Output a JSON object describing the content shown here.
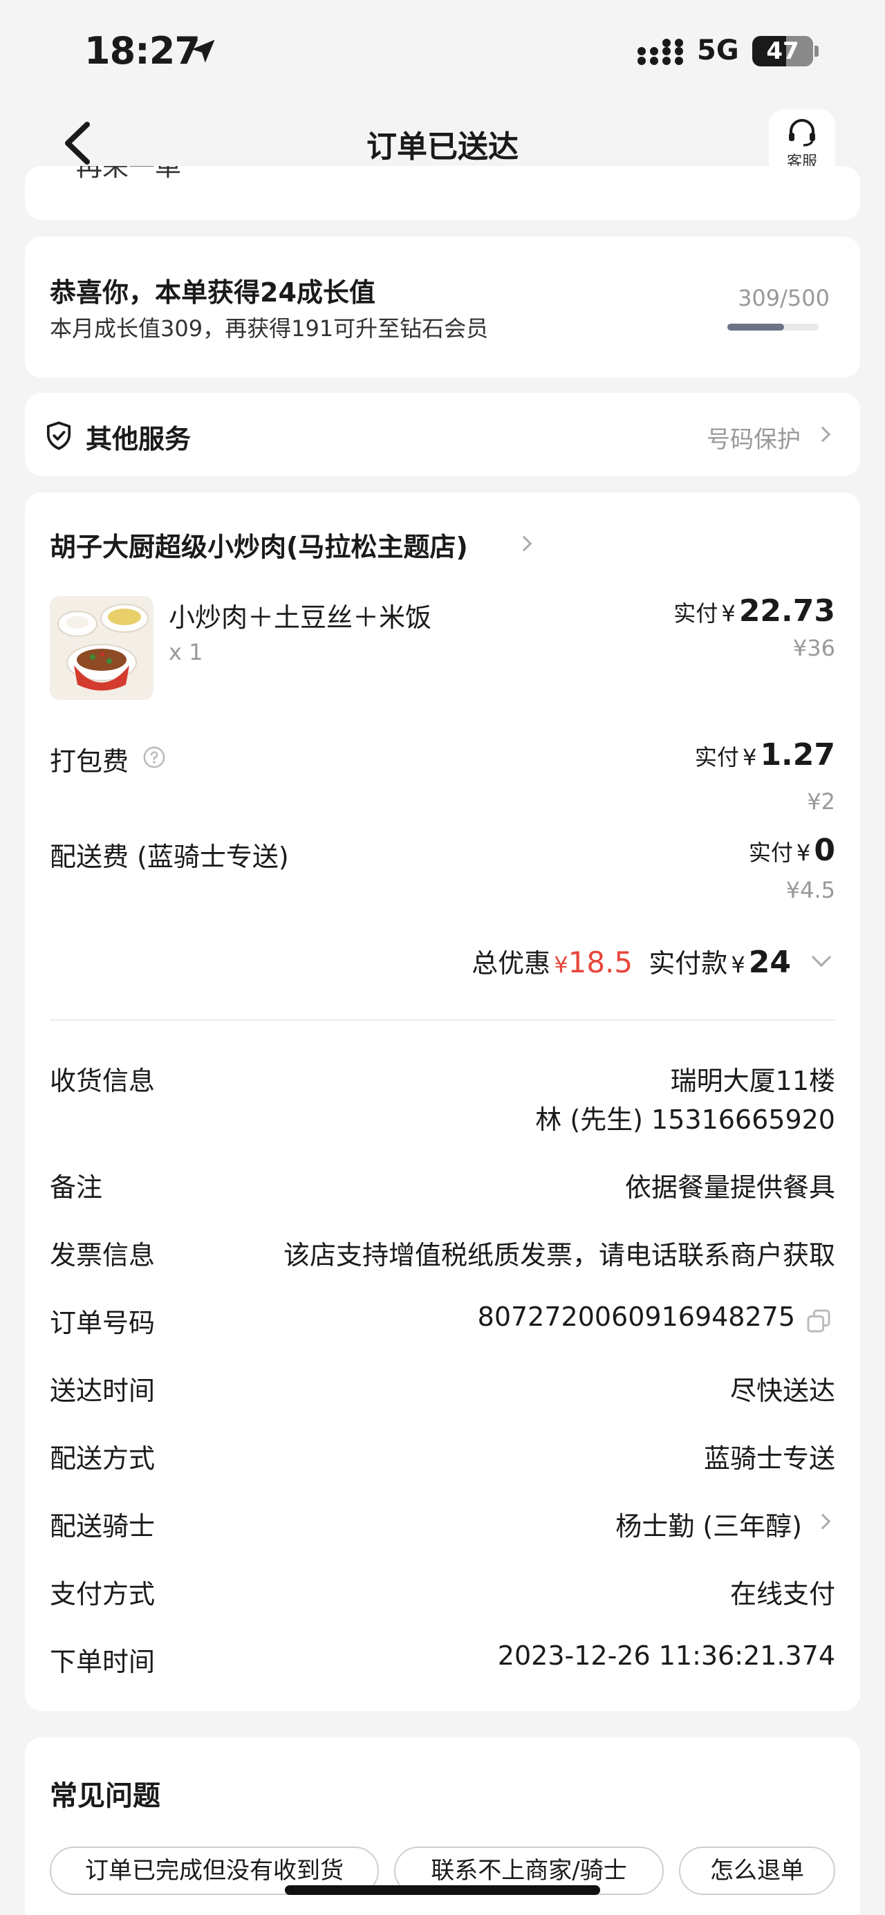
{
  "status_bar": {
    "time": "18:27",
    "network": "5G",
    "battery": "47"
  },
  "nav": {
    "title": "订单已送达",
    "cs_label": "客服"
  },
  "top_card": {
    "partial_text": "再来一单"
  },
  "growth": {
    "title": "恭喜你，本单获得24成长值",
    "subtitle": "本月成长值309，再获得191可升至钻石会员",
    "progress_text": "309/500",
    "progress_fraction": 0.618
  },
  "services": {
    "title": "其他服务",
    "right_text": "号码保护"
  },
  "order": {
    "shop_name": "胡子大厨超级小炒肉(马拉松主题店)",
    "item": {
      "name": "小炒肉＋土豆丝＋米饭",
      "qty": "x 1",
      "paid_label": "实付",
      "currency": "¥",
      "paid": "22.73",
      "original": "¥36"
    },
    "packing": {
      "label": "打包费",
      "paid_label": "实付",
      "currency": "¥",
      "paid": "1.27",
      "original": "¥2"
    },
    "delivery": {
      "label": "配送费 (蓝骑士专送)",
      "paid_label": "实付",
      "currency": "¥",
      "paid": "0",
      "original": "¥4.5"
    },
    "summary": {
      "discount_label": "总优惠",
      "discount_currency": "¥",
      "discount_value": "18.5",
      "total_label": "实付款",
      "total_currency": "¥",
      "total_value": "24"
    },
    "info": {
      "address_label": "收货信息",
      "address_line1": "瑞明大厦11楼",
      "address_line2": "林 (先生) 15316665920",
      "note_label": "备注",
      "note_value": "依据餐量提供餐具",
      "invoice_label": "发票信息",
      "invoice_value": "该店支持增值税纸质发票，请电话联系商户获取",
      "order_no_label": "订单号码",
      "order_no_value": "8072720060916948275",
      "arrive_label": "送达时间",
      "arrive_value": "尽快送达",
      "method_label": "配送方式",
      "method_value": "蓝骑士专送",
      "rider_label": "配送骑士",
      "rider_value": "杨士勤 (三年醇)",
      "pay_label": "支付方式",
      "pay_value": "在线支付",
      "time_label": "下单时间",
      "time_value": "2023-12-26 11:36:21.374"
    }
  },
  "faq": {
    "title": "常见问题",
    "buttons": [
      "订单已完成但没有收到货",
      "联系不上商家/骑士",
      "怎么退单"
    ]
  },
  "colors": {
    "accent_red": "#e8463a",
    "background": "#f4f4f4",
    "progress": "#6c7385"
  }
}
